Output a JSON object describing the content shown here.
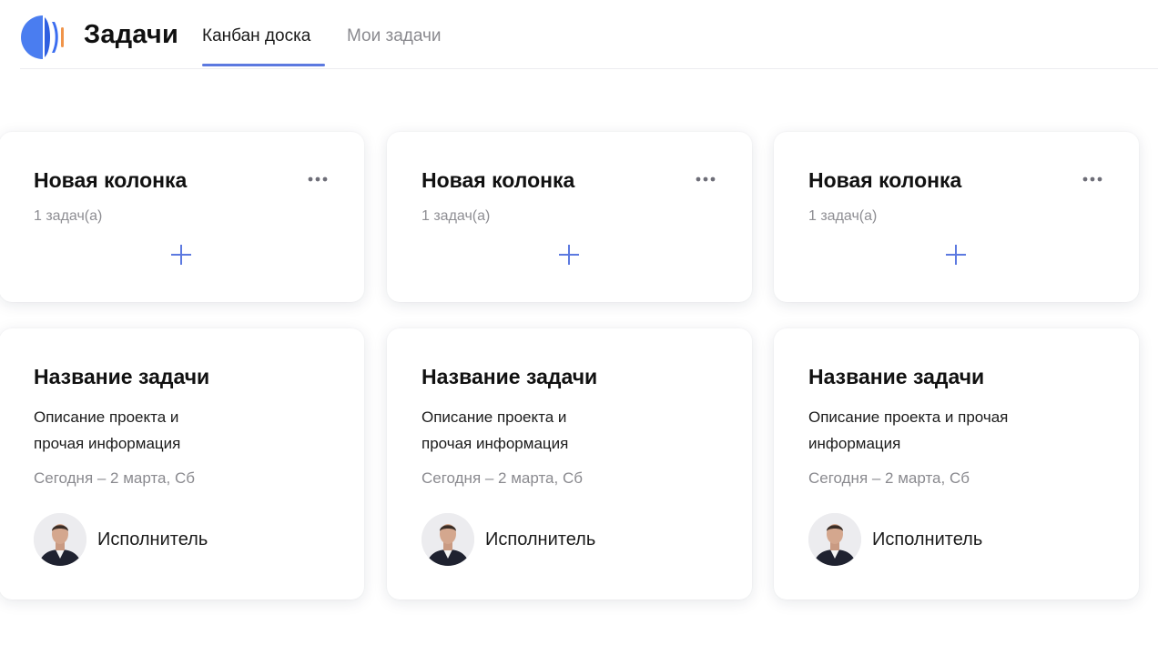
{
  "header": {
    "app_title": "Задачи",
    "tabs": [
      {
        "label": "Канбан доска",
        "active": true
      },
      {
        "label": "Мои задачи",
        "active": false
      }
    ],
    "accent_color": "#5c79e0"
  },
  "columns": [
    {
      "title": "Новая колонка",
      "count": "1 задач(а)"
    },
    {
      "title": "Новая колонка",
      "count": "1 задач(а)"
    },
    {
      "title": "Новая колонка",
      "count": "1 задач(а)"
    }
  ],
  "tasks": [
    {
      "title": "Название задачи",
      "description": "Описание проекта и прочая информация",
      "date": "Сегодня  – 2 марта, Сб",
      "assignee": "Исполнитель"
    },
    {
      "title": "Название задачи",
      "description": "Описание проекта и прочая информация",
      "date": "Сегодня  – 2 марта, Сб",
      "assignee": "Исполнитель"
    },
    {
      "title": "Название задачи",
      "description": "Описание проекта и прочая информация",
      "date": "Сегодня  – 2 марта, Сб",
      "assignee": "Исполнитель"
    }
  ],
  "icons": {
    "logo": "app-logo-icon",
    "more": "more-horizontal-icon",
    "add": "plus-icon",
    "avatar": "user-avatar"
  }
}
